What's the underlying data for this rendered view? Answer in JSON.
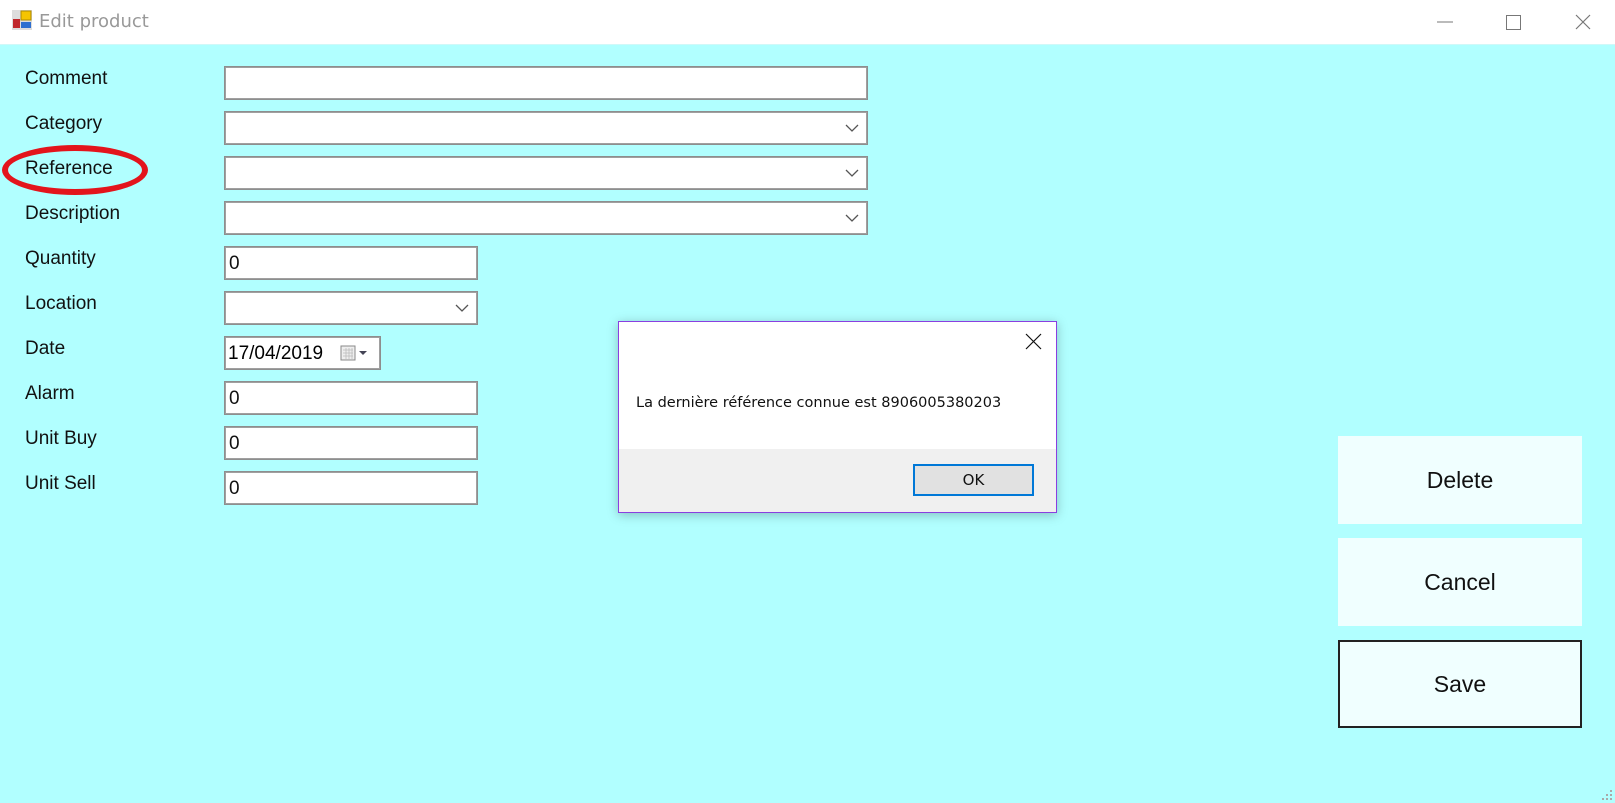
{
  "window": {
    "title": "Edit product",
    "icon": "app-form-icon",
    "controls": [
      "minimize-icon",
      "maximize-icon",
      "close-icon"
    ]
  },
  "form": {
    "fields": [
      {
        "label": "Comment",
        "type": "text",
        "value": ""
      },
      {
        "label": "Category",
        "type": "combobox",
        "value": ""
      },
      {
        "label": "Reference",
        "type": "combobox",
        "value": "",
        "highlighted": true
      },
      {
        "label": "Description",
        "type": "combobox",
        "value": ""
      },
      {
        "label": "Quantity",
        "type": "text",
        "value": "0"
      },
      {
        "label": "Location",
        "type": "combobox",
        "value": ""
      },
      {
        "label": "Date",
        "type": "datepicker",
        "value": "17/04/2019"
      },
      {
        "label": "Alarm",
        "type": "text",
        "value": "0"
      },
      {
        "label": "Unit Buy",
        "type": "text",
        "value": "0"
      },
      {
        "label": "Unit Sell",
        "type": "text",
        "value": "0"
      }
    ]
  },
  "actions": {
    "delete_label": "Delete",
    "cancel_label": "Cancel",
    "save_label": "Save"
  },
  "dialog": {
    "message": "La dernière référence connue est 8906005380203",
    "ok_label": "OK"
  },
  "colors": {
    "background": "#b1ffff",
    "highlight_oval": "#e3141c",
    "dialog_border": "#8a3fe0",
    "ok_focus": "#0078d7"
  }
}
